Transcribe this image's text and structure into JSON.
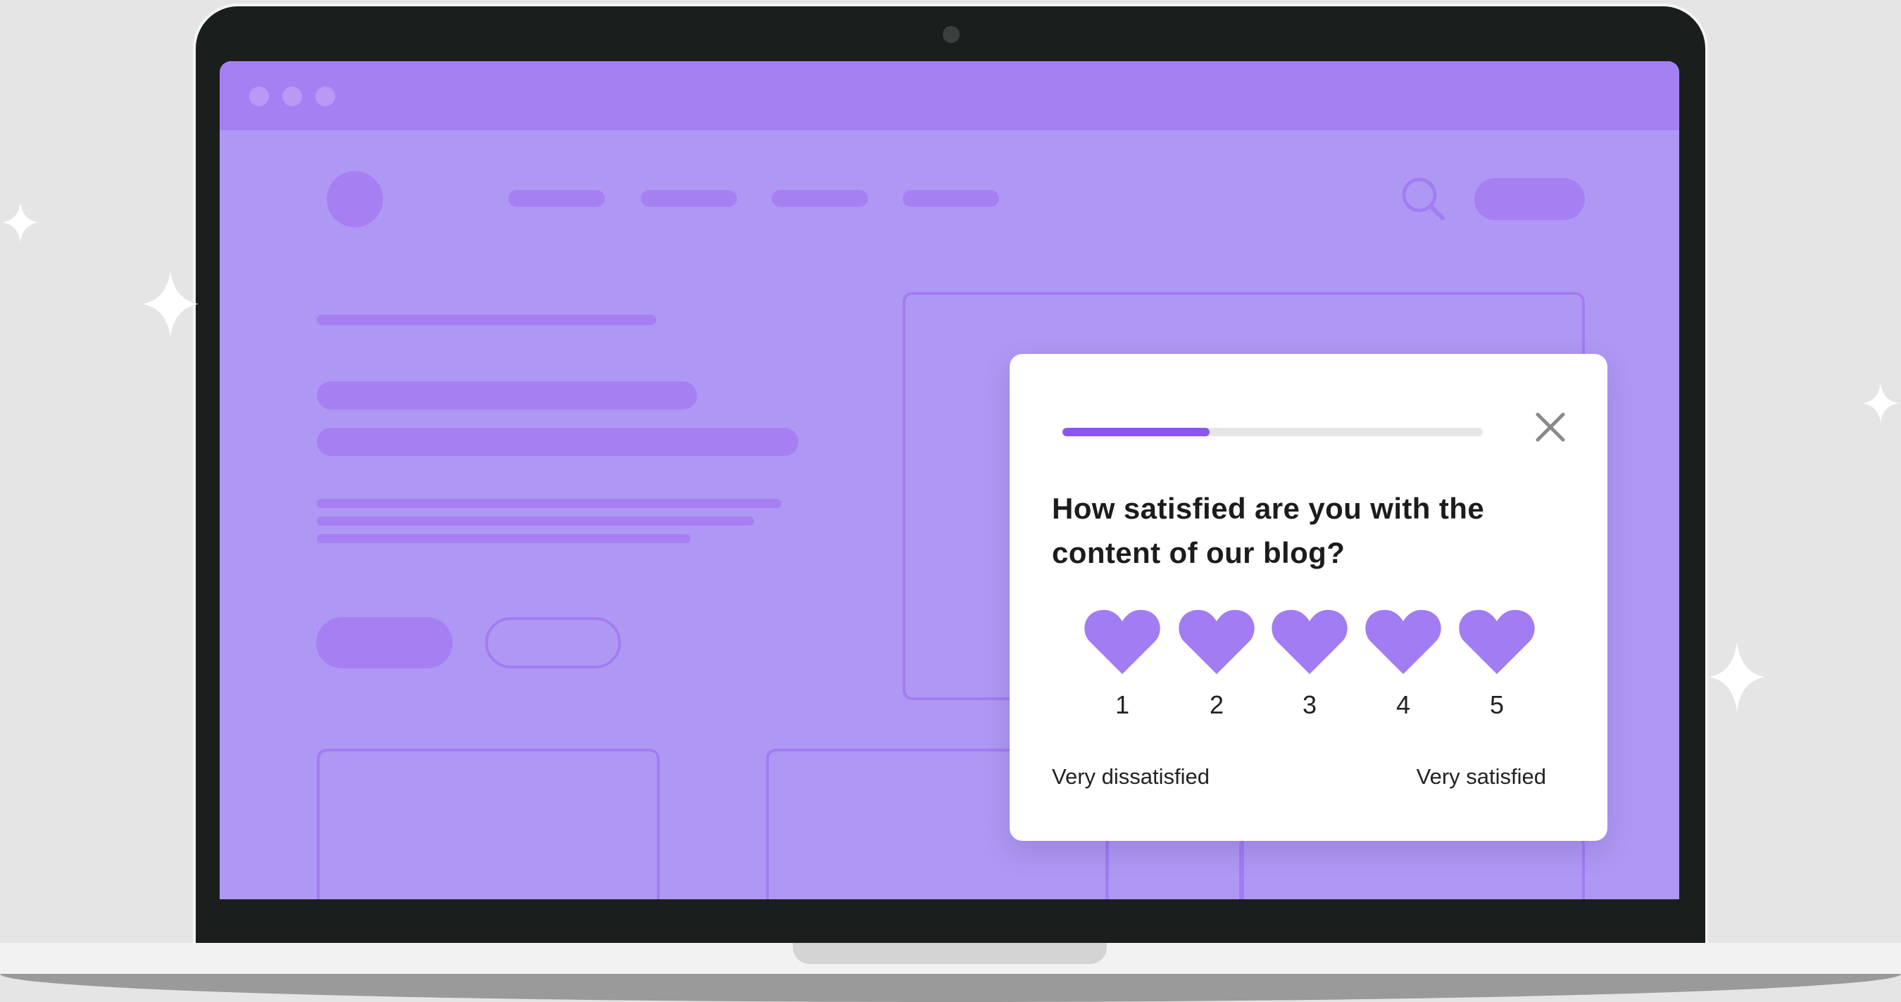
{
  "survey": {
    "progress_percent": 35,
    "question": "How satisfied are you with the content of our blog?",
    "rating_options": [
      "1",
      "2",
      "3",
      "4",
      "5"
    ],
    "low_label": "Very dissatisfied",
    "high_label": "Very satisfied",
    "close_icon": "close-icon",
    "rating_icon": "heart-icon"
  },
  "colors": {
    "accent": "#8b56ee",
    "heart": "#a27cf2",
    "screen_bg": "#af98f3",
    "titlebar": "#a580f3"
  }
}
